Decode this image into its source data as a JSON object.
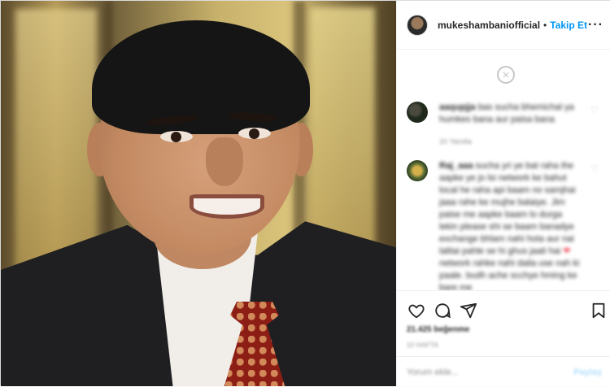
{
  "post": {
    "username": "mukeshambaniofficial",
    "separator": "•",
    "follow_label": "Takip Et",
    "more_label": "···"
  },
  "comments": [
    {
      "user": "aaqupjja",
      "text": "bas sucha bhemichal ya humkes bana aur paisa bana",
      "meta": "1h   Yanıtla"
    },
    {
      "user": "Raj_aaa",
      "text": "sucha yri ye bat raha the aapke ye jo lsi network ke bahut local he raha api baam no samjhai jaaa rahe ke mujhe balaiye. Jim paise me aapke baam lo durga lekin please shi se baam banadye exchange bhlam nahi hota aur nai lalitai pahle se hi ghus jaati hai",
      "text_tail": "network rahke nahi daila use nah ki paale. budh ache scchye hming ke bare me",
      "meta": ""
    }
  ],
  "actions": {
    "like_icon": "heart-icon",
    "comment_icon": "comment-icon",
    "share_icon": "share-icon",
    "save_icon": "bookmark-icon",
    "likes_text": "21.425 beğenme",
    "time_text": "10 HAFTA"
  },
  "add_comment": {
    "placeholder": "Yorum ekle...",
    "post_label": "Paylaş"
  },
  "colors": {
    "accent": "#0095f6",
    "text": "#262626",
    "muted": "#8e8e8e",
    "border": "#efefef",
    "heart": "#ed4956"
  }
}
